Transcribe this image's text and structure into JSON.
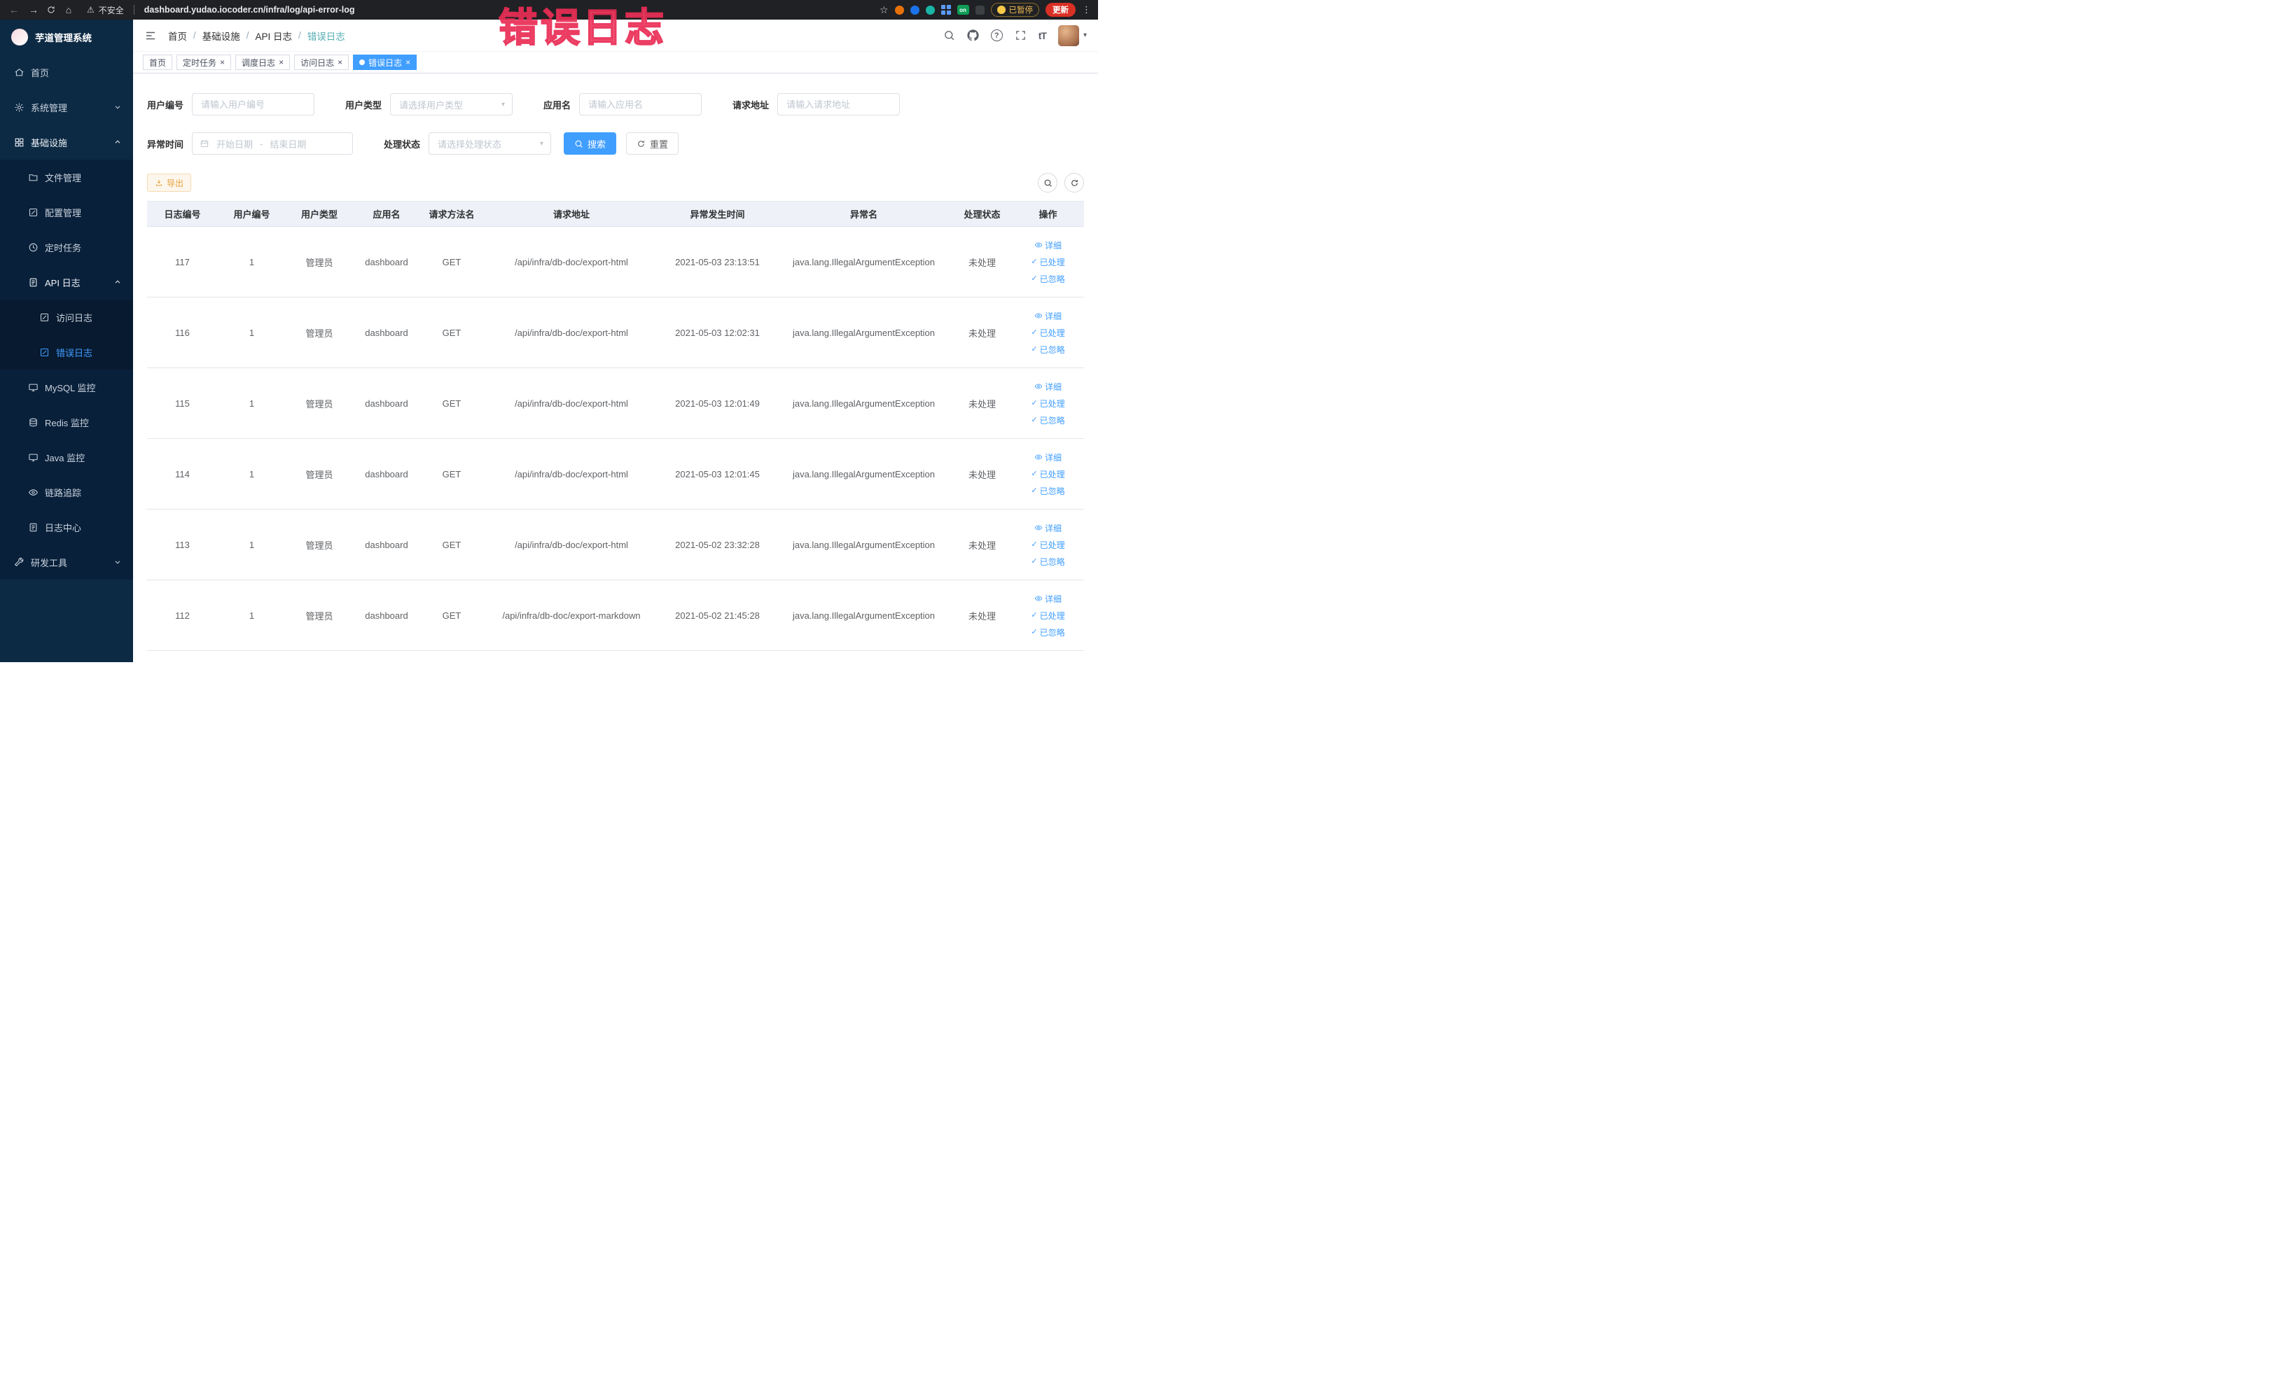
{
  "annotation": {
    "text": "错误日志"
  },
  "icons": {
    "back": "←",
    "forward": "→",
    "home": "⌂",
    "warning": "⚠",
    "star": "☆",
    "kebab": "⋮",
    "close": "×",
    "caret_down": "▾",
    "question": "?",
    "font_size": "tT",
    "check": "✓"
  },
  "browser": {
    "security_label": "不安全",
    "url": "dashboard.yudao.iocoder.cn/infra/log/api-error-log",
    "ext_on_label": "on",
    "paused_label": "已暂停",
    "update_label": "更新"
  },
  "sidebar": {
    "title": "芋道管理系统",
    "menu": [
      {
        "label": "首页"
      },
      {
        "label": "系统管理"
      },
      {
        "label": "基础设施"
      },
      {
        "label": "文件管理"
      },
      {
        "label": "配置管理"
      },
      {
        "label": "定时任务"
      },
      {
        "label": "API 日志"
      },
      {
        "label": "访问日志"
      },
      {
        "label": "错误日志"
      },
      {
        "label": "MySQL 监控"
      },
      {
        "label": "Redis 监控"
      },
      {
        "label": "Java 监控"
      },
      {
        "label": "链路追踪"
      },
      {
        "label": "日志中心"
      },
      {
        "label": "研发工具"
      }
    ]
  },
  "breadcrumb": {
    "separator": "/",
    "items": [
      "首页",
      "基础设施",
      "API 日志",
      "错误日志"
    ]
  },
  "tabs": [
    {
      "label": "首页"
    },
    {
      "label": "定时任务"
    },
    {
      "label": "调度日志"
    },
    {
      "label": "访问日志"
    },
    {
      "label": "错误日志"
    }
  ],
  "filters": {
    "user_id_label": "用户编号",
    "user_id_placeholder": "请输入用户编号",
    "user_type_label": "用户类型",
    "user_type_placeholder": "请选择用户类型",
    "app_name_label": "应用名",
    "app_name_placeholder": "请输入应用名",
    "request_url_label": "请求地址",
    "request_url_placeholder": "请输入请求地址",
    "exception_time_label": "异常时间",
    "date_start_placeholder": "开始日期",
    "date_separator": "-",
    "date_end_placeholder": "结束日期",
    "process_status_label": "处理状态",
    "process_status_placeholder": "请选择处理状态",
    "search_label": "搜索",
    "reset_label": "重置"
  },
  "toolbar": {
    "export_label": "导出"
  },
  "table": {
    "columns": [
      "日志编号",
      "用户编号",
      "用户类型",
      "应用名",
      "请求方法名",
      "请求地址",
      "异常发生时间",
      "异常名",
      "处理状态",
      "操作"
    ],
    "action_detail": "详细",
    "action_processed": "已处理",
    "action_ignored": "已忽略",
    "rows": [
      {
        "id": "117",
        "user_id": "1",
        "user_type": "管理员",
        "app": "dashboard",
        "method": "GET",
        "url": "/api/infra/db-doc/export-html",
        "time": "2021-05-03 23:13:51",
        "exception": "java.lang.IllegalArgumentException",
        "status": "未处理"
      },
      {
        "id": "116",
        "user_id": "1",
        "user_type": "管理员",
        "app": "dashboard",
        "method": "GET",
        "url": "/api/infra/db-doc/export-html",
        "time": "2021-05-03 12:02:31",
        "exception": "java.lang.IllegalArgumentException",
        "status": "未处理"
      },
      {
        "id": "115",
        "user_id": "1",
        "user_type": "管理员",
        "app": "dashboard",
        "method": "GET",
        "url": "/api/infra/db-doc/export-html",
        "time": "2021-05-03 12:01:49",
        "exception": "java.lang.IllegalArgumentException",
        "status": "未处理"
      },
      {
        "id": "114",
        "user_id": "1",
        "user_type": "管理员",
        "app": "dashboard",
        "method": "GET",
        "url": "/api/infra/db-doc/export-html",
        "time": "2021-05-03 12:01:45",
        "exception": "java.lang.IllegalArgumentException",
        "status": "未处理"
      },
      {
        "id": "113",
        "user_id": "1",
        "user_type": "管理员",
        "app": "dashboard",
        "method": "GET",
        "url": "/api/infra/db-doc/export-html",
        "time": "2021-05-02 23:32:28",
        "exception": "java.lang.IllegalArgumentException",
        "status": "未处理"
      },
      {
        "id": "112",
        "user_id": "1",
        "user_type": "管理员",
        "app": "dashboard",
        "method": "GET",
        "url": "/api/infra/db-doc/export-markdown",
        "time": "2021-05-02 21:45:28",
        "exception": "java.lang.IllegalArgumentException",
        "status": "未处理"
      }
    ]
  }
}
